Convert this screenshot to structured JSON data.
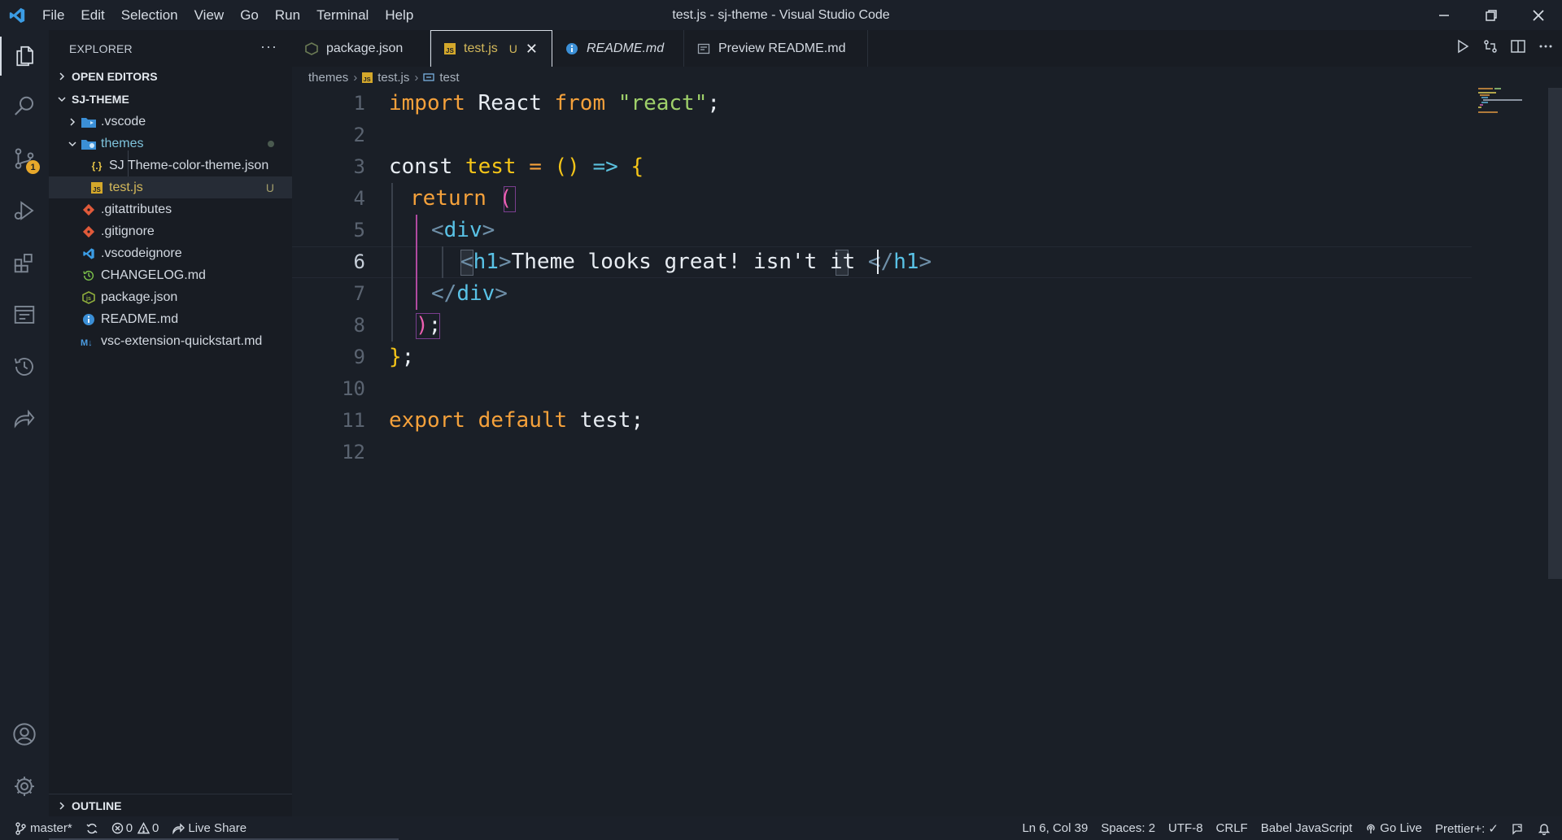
{
  "titlebar": {
    "menu": [
      "File",
      "Edit",
      "Selection",
      "View",
      "Go",
      "Run",
      "Terminal",
      "Help"
    ],
    "title": "test.js - sj-theme - Visual Studio Code"
  },
  "activitybar": {
    "scm_badge": "1"
  },
  "sidebar": {
    "header": "EXPLORER",
    "more": "···",
    "open_editors": "OPEN EDITORS",
    "project": "SJ-THEME",
    "items": [
      {
        "label": ".vscode",
        "type": "folder"
      },
      {
        "label": "themes",
        "type": "folder-open"
      },
      {
        "label": "SJ Theme-color-theme.json",
        "type": "json"
      },
      {
        "label": "test.js",
        "type": "js",
        "decoration": "U"
      },
      {
        "label": ".gitattributes",
        "type": "git"
      },
      {
        "label": ".gitignore",
        "type": "git"
      },
      {
        "label": ".vscodeignore",
        "type": "vscode"
      },
      {
        "label": "CHANGELOG.md",
        "type": "changelog"
      },
      {
        "label": "package.json",
        "type": "npm"
      },
      {
        "label": "README.md",
        "type": "info"
      },
      {
        "label": "vsc-extension-quickstart.md",
        "type": "markdown"
      }
    ],
    "outline": "OUTLINE"
  },
  "tabs": [
    {
      "label": "package.json"
    },
    {
      "label": "test.js",
      "modified": "U",
      "close": "✕"
    },
    {
      "label": "README.md"
    },
    {
      "label": "Preview README.md"
    }
  ],
  "breadcrumb": {
    "folder": "themes",
    "file": "test.js",
    "symbol": "test"
  },
  "editor": {
    "line_numbers": [
      "1",
      "2",
      "3",
      "4",
      "5",
      "6",
      "7",
      "8",
      "9",
      "10",
      "11",
      "12"
    ],
    "code": {
      "l1_import": "import",
      "l1_react": " React ",
      "l1_from": "from",
      "l1_str": " \"react\"",
      "l1_semi": ";",
      "l3_const": "const",
      "l3_test": " test",
      "l3_eq": " = ",
      "l3_parens": "()",
      "l3_arrow": " => ",
      "l3_brace": "{",
      "l4_return": "return",
      "l4_paren": "(",
      "l5_lt": "<",
      "l5_div": "div",
      "l5_gt": ">",
      "l6_lt": "<",
      "l6_h1": "h1",
      "l6_gt": ">",
      "l6_text": "Theme looks great! isn't it ",
      "l6_close_lt": "</",
      "l6_close_h1": "h1",
      "l6_close_gt": ">",
      "l7_lt": "</",
      "l7_div": "div",
      "l7_gt": ">",
      "l8_paren": ")",
      "l8_semi": ";",
      "l9_brace": "}",
      "l9_semi": ";",
      "l11_export": "export",
      "l11_default": " default",
      "l11_test": " test",
      "l11_semi": ";"
    }
  },
  "statusbar": {
    "branch": "master*",
    "errors": "0",
    "warnings": "0",
    "live_share": "Live Share",
    "position": "Ln 6, Col 39",
    "spaces": "Spaces: 2",
    "encoding": "UTF-8",
    "eol": "CRLF",
    "language": "Babel JavaScript",
    "go_live": "Go Live",
    "prettier": "Prettier+: ✓"
  },
  "colors": {
    "background": "#1a1f27",
    "sidebar": "#181c23",
    "keyword": "#f5a13b",
    "string": "#9fd06a",
    "function": "#f5c518",
    "tag": "#59c2e6",
    "badge": "#e8a82b"
  }
}
